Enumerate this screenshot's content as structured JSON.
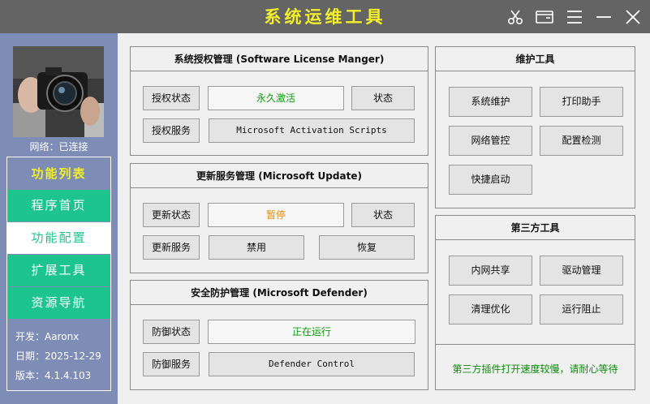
{
  "window": {
    "title": "系统运维工具",
    "icons": [
      "scissors-icon",
      "window-icon",
      "menu-icon",
      "minimize-icon",
      "close-icon"
    ]
  },
  "sidebar": {
    "network_status": "网络：已连接",
    "menu_title": "功能列表",
    "items": [
      {
        "label": "程序首页",
        "active": false
      },
      {
        "label": "功能配置",
        "active": true
      },
      {
        "label": "扩展工具",
        "active": false
      },
      {
        "label": "资源导航",
        "active": false
      }
    ],
    "info": {
      "developer": "开发：Aaronx",
      "date": "日期：2025-12-29",
      "version": "版本：4.1.4.103"
    }
  },
  "license": {
    "title": "系统授权管理 (Software License Manger)",
    "status_label": "授权状态",
    "status_value": "永久激活",
    "status_button": "状态",
    "service_label": "授权服务",
    "service_value": "Microsoft Activation Scripts"
  },
  "update": {
    "title": "更新服务管理 (Microsoft Update)",
    "status_label": "更新状态",
    "status_value": "暂停",
    "status_button": "状态",
    "service_label": "更新服务",
    "disable_button": "禁用",
    "restore_button": "恢复"
  },
  "defender": {
    "title": "安全防护管理 (Microsoft Defender)",
    "status_label": "防御状态",
    "status_value": "正在运行",
    "service_label": "防御服务",
    "service_value": "Defender Control"
  },
  "maintenance": {
    "title": "维护工具",
    "buttons": [
      "系统维护",
      "打印助手",
      "网络管控",
      "配置检测",
      "快捷启动"
    ]
  },
  "third_party": {
    "title": "第三方工具",
    "buttons": [
      "内网共享",
      "驱动管理",
      "清理优化",
      "运行阻止"
    ],
    "note": "第三方插件打开速度较慢，请耐心等待"
  },
  "colors": {
    "titlebar": "#646464",
    "title_text": "#f2ee2a",
    "sidebar": "#7d8db6",
    "menu_item": "#1ec48e",
    "ok_text": "#0f9b0f",
    "warn_text": "#ea8a00"
  }
}
